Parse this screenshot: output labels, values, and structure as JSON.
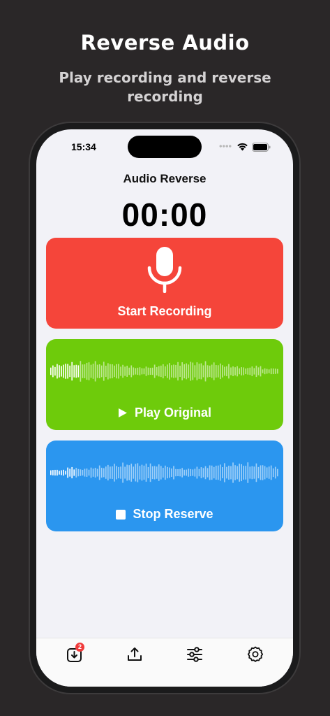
{
  "promo": {
    "title": "Reverse Audio",
    "subtitle": "Play recording and reverse recording"
  },
  "status_bar": {
    "time": "15:34"
  },
  "app": {
    "title": "Audio Reverse",
    "timer": "00:00"
  },
  "cards": {
    "record": {
      "label": "Start Recording",
      "color": "#f5453a",
      "icon": "microphone-icon"
    },
    "original": {
      "label": "Play Original",
      "color": "#6ecb0b",
      "icon": "play-icon"
    },
    "reverse": {
      "label": "Stop Reserve",
      "color": "#2b96ef",
      "icon": "stop-icon"
    }
  },
  "tabbar": {
    "items": [
      {
        "icon": "import-icon",
        "badge": "2"
      },
      {
        "icon": "share-icon"
      },
      {
        "icon": "sliders-icon"
      },
      {
        "icon": "settings-icon"
      }
    ]
  }
}
